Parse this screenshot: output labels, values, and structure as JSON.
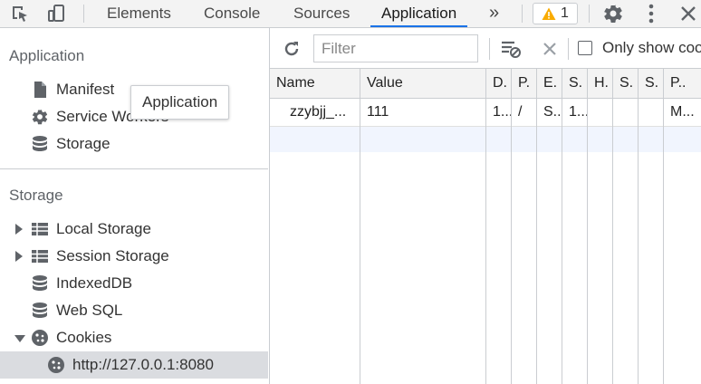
{
  "devtools": {
    "tabs": [
      {
        "label": "Elements"
      },
      {
        "label": "Console"
      },
      {
        "label": "Sources"
      },
      {
        "label": "Application",
        "active": true
      }
    ],
    "more_tabs": "»",
    "warning_count": "1"
  },
  "sidebar": {
    "application_title": "Application",
    "app_items": [
      {
        "label": "Manifest",
        "icon": "document-icon"
      },
      {
        "label": "Service Workers",
        "icon": "gear-icon"
      },
      {
        "label": "Storage",
        "icon": "database-icon"
      }
    ],
    "storage_title": "Storage",
    "storage_items": [
      {
        "label": "Local Storage",
        "icon": "grid-icon",
        "expandable": "collapsed"
      },
      {
        "label": "Session Storage",
        "icon": "grid-icon",
        "expandable": "collapsed"
      },
      {
        "label": "IndexedDB",
        "icon": "database-icon"
      },
      {
        "label": "Web SQL",
        "icon": "database-icon"
      },
      {
        "label": "Cookies",
        "icon": "cookie-icon",
        "expandable": "expanded"
      }
    ],
    "cookie_origin": "http://127.0.0.1:8080"
  },
  "tooltip": "Application",
  "toolbar": {
    "filter_placeholder": "Filter",
    "only_show_label": "Only show coo"
  },
  "cookie_table": {
    "headers": [
      "Name",
      "Value",
      "D.",
      "P.",
      "E.",
      "S.",
      "H.",
      "S.",
      "S.",
      "P.."
    ],
    "rows": [
      [
        "zzybjj_...",
        "111",
        "1...",
        "/",
        "S...",
        "1...",
        "",
        "",
        "",
        "M..."
      ]
    ]
  },
  "colors": {
    "accent": "#1a73e8",
    "warning": "#f9ab00",
    "selected_row": "#dadce0"
  }
}
